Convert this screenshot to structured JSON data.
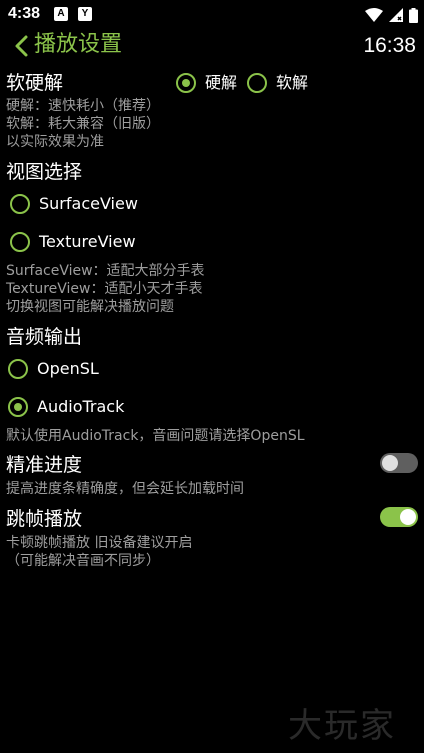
{
  "status_bar": {
    "time": "4:38",
    "notif_icons": [
      "A",
      "Y"
    ]
  },
  "header": {
    "title": "播放设置",
    "clock": "16:38"
  },
  "decoder": {
    "title": "软硬解",
    "options": [
      {
        "label": "硬解",
        "checked": true
      },
      {
        "label": "软解",
        "checked": false
      }
    ],
    "desc": [
      "硬解：速快耗小（推荐）",
      "软解：耗大兼容（旧版）",
      "以实际效果为准"
    ]
  },
  "view": {
    "title": "视图选择",
    "options": [
      {
        "label": "SurfaceView",
        "checked": false
      },
      {
        "label": "TextureView",
        "checked": false
      }
    ],
    "desc": [
      "SurfaceView：适配大部分手表",
      "TextureView：适配小天才手表",
      "切换视图可能解决播放问题"
    ]
  },
  "audio": {
    "title": "音频输出",
    "options": [
      {
        "label": "OpenSL",
        "checked": false
      },
      {
        "label": "AudioTrack",
        "checked": true
      }
    ],
    "desc": "默认使用AudioTrack，音画问题请选择OpenSL"
  },
  "precise_progress": {
    "title": "精准进度",
    "desc": "提高进度条精确度，但会延长加载时间",
    "enabled": false
  },
  "frame_skip": {
    "title": "跳帧播放",
    "desc": [
      "卡顿跳帧播放 旧设备建议开启",
      "（可能解决音画不同步）"
    ],
    "enabled": true
  },
  "watermark": "大玩家",
  "colors": {
    "accent": "#8bc34a",
    "background": "#000000",
    "desc_text": "#9e9e9e"
  }
}
